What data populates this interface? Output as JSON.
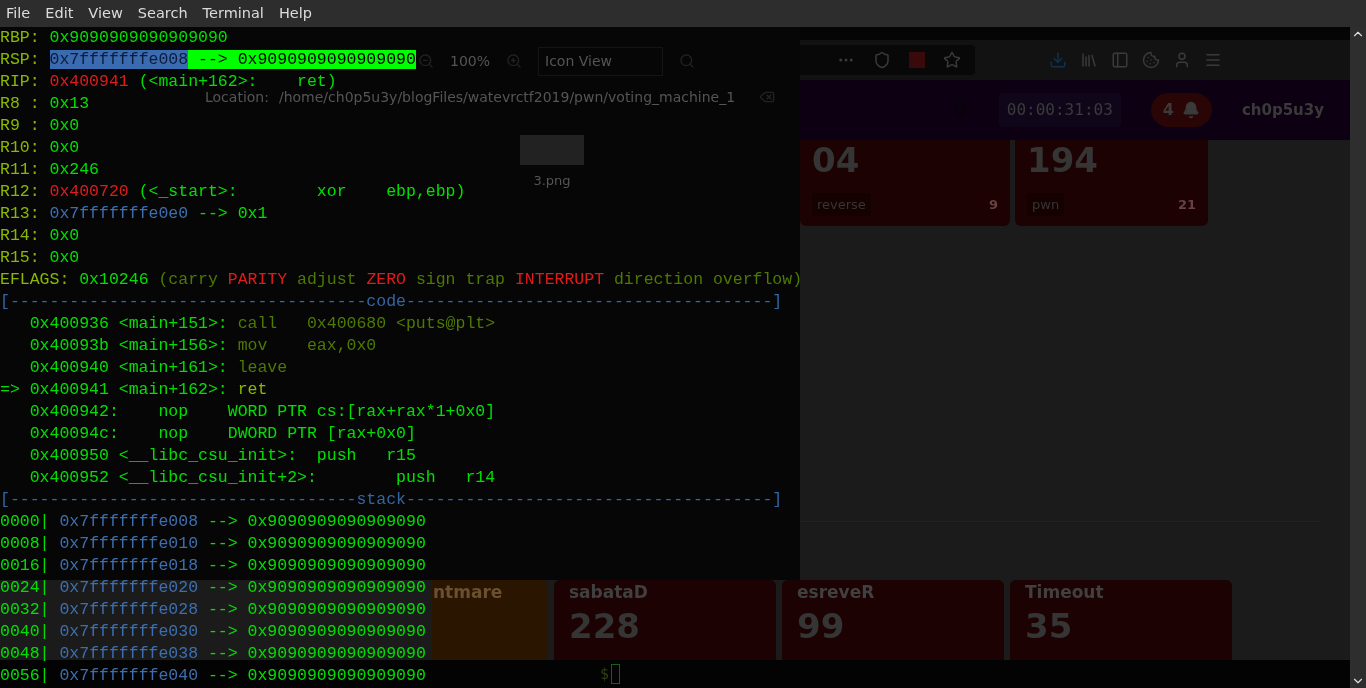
{
  "terminal": {
    "menu": [
      "File",
      "Edit",
      "View",
      "Search",
      "Terminal",
      "Help"
    ],
    "lines": [
      {
        "segments": [
          {
            "text": "RBP: ",
            "kind": "label"
          },
          {
            "text": "0x9090909090909090",
            "kind": "value"
          }
        ]
      },
      {
        "segments": [
          {
            "text": "RSP: ",
            "kind": "label"
          },
          {
            "text": "0x7fffffffe008",
            "kind": "hl-blue"
          },
          {
            "text": " --> 0x9090909090909090",
            "kind": "hl-green"
          }
        ]
      },
      {
        "segments": [
          {
            "text": "RIP: ",
            "kind": "label"
          },
          {
            "text": "0x400941",
            "kind": "red"
          },
          {
            "text": " (<main+162>:    ret)",
            "kind": "value"
          }
        ]
      },
      {
        "segments": [
          {
            "text": "R8 : ",
            "kind": "label"
          },
          {
            "text": "0x13",
            "kind": "value"
          }
        ]
      },
      {
        "segments": [
          {
            "text": "R9 : ",
            "kind": "label"
          },
          {
            "text": "0x0",
            "kind": "value"
          }
        ]
      },
      {
        "segments": [
          {
            "text": "R10: ",
            "kind": "label"
          },
          {
            "text": "0x0",
            "kind": "value"
          }
        ]
      },
      {
        "segments": [
          {
            "text": "R11: ",
            "kind": "label"
          },
          {
            "text": "0x246",
            "kind": "value"
          }
        ]
      },
      {
        "segments": [
          {
            "text": "R12: ",
            "kind": "label"
          },
          {
            "text": "0x400720",
            "kind": "red"
          },
          {
            "text": " (<_start>:        xor    ebp,ebp)",
            "kind": "value"
          }
        ]
      },
      {
        "segments": [
          {
            "text": "R13: ",
            "kind": "label"
          },
          {
            "text": "0x7fffffffe0e0",
            "kind": "blue"
          },
          {
            "text": " --> 0x1",
            "kind": "value"
          }
        ]
      },
      {
        "segments": [
          {
            "text": "R14: ",
            "kind": "label"
          },
          {
            "text": "0x0",
            "kind": "value"
          }
        ]
      },
      {
        "segments": [
          {
            "text": "R15: ",
            "kind": "label"
          },
          {
            "text": "0x0",
            "kind": "value"
          }
        ]
      },
      {
        "segments": [
          {
            "text": "EFLAGS: ",
            "kind": "label"
          },
          {
            "text": "0x10246",
            "kind": "value"
          },
          {
            "text": " (carry ",
            "kind": "dim"
          },
          {
            "text": "PARITY",
            "kind": "red"
          },
          {
            "text": " adjust ",
            "kind": "dim"
          },
          {
            "text": "ZERO",
            "kind": "red"
          },
          {
            "text": " sign trap ",
            "kind": "dim"
          },
          {
            "text": "INTERRUPT",
            "kind": "red"
          },
          {
            "text": " direction overflow)",
            "kind": "dim"
          }
        ]
      },
      {
        "segments": [
          {
            "text": "[------------------------------------code-------------------------------------]",
            "kind": "sep"
          }
        ]
      },
      {
        "segments": [
          {
            "text": "   0x400936 <main+151>: ",
            "kind": "value"
          },
          {
            "text": "call   0x400680 <puts@plt>",
            "kind": "dim"
          }
        ]
      },
      {
        "segments": [
          {
            "text": "   0x40093b <main+156>: ",
            "kind": "value"
          },
          {
            "text": "mov    eax,0x0",
            "kind": "dim"
          }
        ]
      },
      {
        "segments": [
          {
            "text": "   0x400940 <main+161>: ",
            "kind": "value"
          },
          {
            "text": "leave",
            "kind": "dim"
          }
        ]
      },
      {
        "segments": [
          {
            "text": "=> 0x400941 <main+162>: ",
            "kind": "value"
          },
          {
            "text": "ret",
            "kind": "label"
          }
        ]
      },
      {
        "segments": [
          {
            "text": "   0x400942:    nop    WORD PTR cs:[rax+rax*1+0x0]",
            "kind": "value"
          }
        ]
      },
      {
        "segments": [
          {
            "text": "   0x40094c:    nop    DWORD PTR [rax+0x0]",
            "kind": "value"
          }
        ]
      },
      {
        "segments": [
          {
            "text": "   0x400950 <__libc_csu_init>:  push   r15",
            "kind": "value"
          }
        ]
      },
      {
        "segments": [
          {
            "text": "   0x400952 <__libc_csu_init+2>:        push   r14",
            "kind": "value"
          }
        ]
      },
      {
        "segments": [
          {
            "text": "[-----------------------------------stack-------------------------------------]",
            "kind": "sep"
          }
        ]
      },
      {
        "segments": [
          {
            "text": "0000| ",
            "kind": "value"
          },
          {
            "text": "0x7fffffffe008",
            "kind": "blue"
          },
          {
            "text": " --> 0x9090909090909090",
            "kind": "value"
          }
        ]
      },
      {
        "segments": [
          {
            "text": "0008| ",
            "kind": "value"
          },
          {
            "text": "0x7fffffffe010",
            "kind": "blue"
          },
          {
            "text": " --> 0x9090909090909090",
            "kind": "value"
          }
        ]
      },
      {
        "segments": [
          {
            "text": "0016| ",
            "kind": "value"
          },
          {
            "text": "0x7fffffffe018",
            "kind": "blue"
          },
          {
            "text": " --> 0x9090909090909090",
            "kind": "value"
          }
        ]
      },
      {
        "segments": [
          {
            "text": "0024| ",
            "kind": "value"
          },
          {
            "text": "0x7fffffffe020",
            "kind": "blue"
          },
          {
            "text": " --> 0x9090909090909090",
            "kind": "value"
          }
        ]
      },
      {
        "segments": [
          {
            "text": "0032| ",
            "kind": "value"
          },
          {
            "text": "0x7fffffffe028",
            "kind": "blue"
          },
          {
            "text": " --> 0x9090909090909090",
            "kind": "value"
          }
        ]
      },
      {
        "segments": [
          {
            "text": "0040| ",
            "kind": "value"
          },
          {
            "text": "0x7fffffffe030",
            "kind": "blue"
          },
          {
            "text": " --> 0x9090909090909090",
            "kind": "value"
          }
        ]
      },
      {
        "segments": [
          {
            "text": "0048| ",
            "kind": "value"
          },
          {
            "text": "0x7fffffffe038",
            "kind": "blue"
          },
          {
            "text": " --> 0x9090909090909090",
            "kind": "value"
          }
        ]
      },
      {
        "segments": [
          {
            "text": "0056| ",
            "kind": "value"
          },
          {
            "text": "0x7fffffffe040",
            "kind": "blue"
          },
          {
            "text": " --> 0x9090909090909090",
            "kind": "value"
          }
        ]
      }
    ],
    "prompt": "$"
  },
  "file_manager": {
    "zoom": "100%",
    "view": "Icon View",
    "location_label": "Location:",
    "location": "/home/ch0p5u3y/blogFiles/watevrctf2019/pwn/voting_machine_1",
    "files": [
      "3.png"
    ]
  },
  "browser": {
    "timer": "00:00:31:03",
    "notification_count": "4",
    "username": "ch0p5u3y",
    "top_cards": [
      {
        "value": "04",
        "tags": [
          "reverse"
        ],
        "count": "9",
        "color": "#1c0202"
      },
      {
        "value": "194",
        "tags": [
          "pwn"
        ],
        "count": "21",
        "color": "#1c0202"
      }
    ],
    "bottom_cards": [
      {
        "title": "ntmare",
        "color": "#2a1600"
      },
      {
        "title": "sabataD",
        "value": "228",
        "color": "#1c0202"
      },
      {
        "title": "esreveR",
        "value": "99",
        "color": "#1c0202"
      },
      {
        "title": "Timeout",
        "value": "35",
        "color": "#1c0202"
      }
    ]
  }
}
